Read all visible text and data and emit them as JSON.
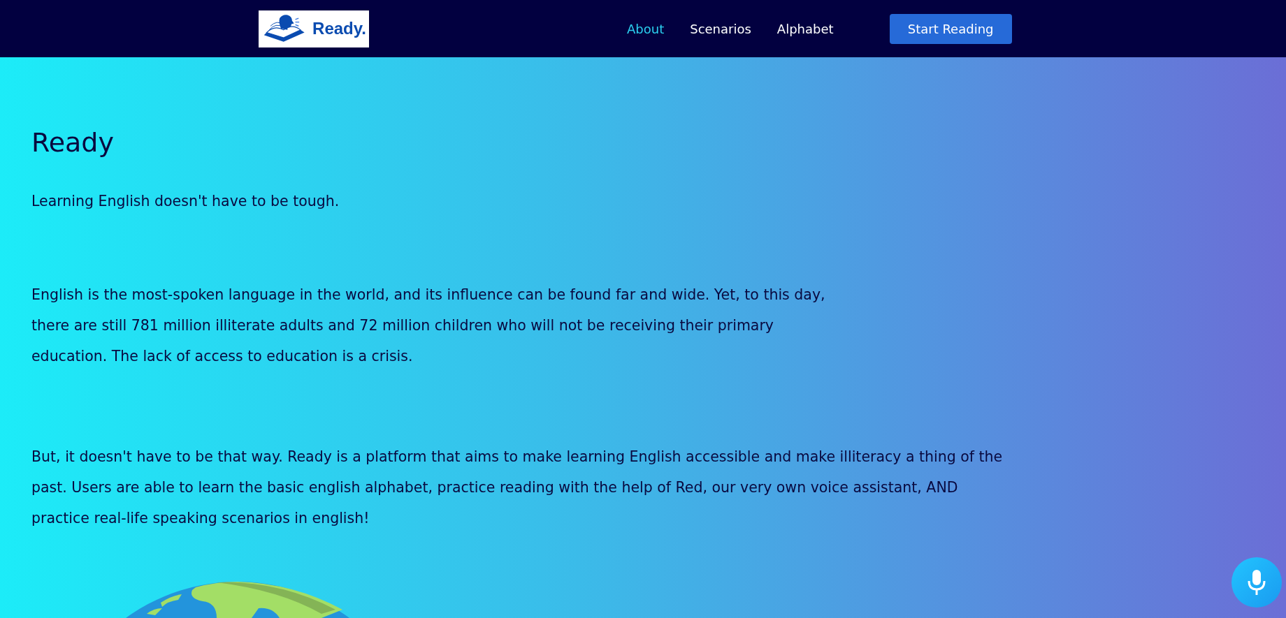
{
  "header": {
    "logo_text": "Ready.",
    "nav": [
      {
        "label": "About",
        "selected": true
      },
      {
        "label": "Scenarios",
        "selected": false
      },
      {
        "label": "Alphabet",
        "selected": false
      }
    ],
    "cta_button": "Start Reading"
  },
  "main": {
    "title": "Ready",
    "tagline": "Learning English doesn't have to be tough.",
    "paragraphs": [
      "English is the most-spoken language in the world, and its influence can be found far and wide. Yet, to this day, there are still 781 million illiterate adults and 72 million children who will not be receiving their primary education. The lack of access to education is a crisis.",
      "But, it doesn't have to be that way. Ready is a platform that aims to make learning English accessible and make illiteracy a thing of the past. Users are able to learn the basic english alphabet, practice reading with the help of Red, our very own voice assistant, AND practice real-life speaking scenarios in english!"
    ]
  }
}
